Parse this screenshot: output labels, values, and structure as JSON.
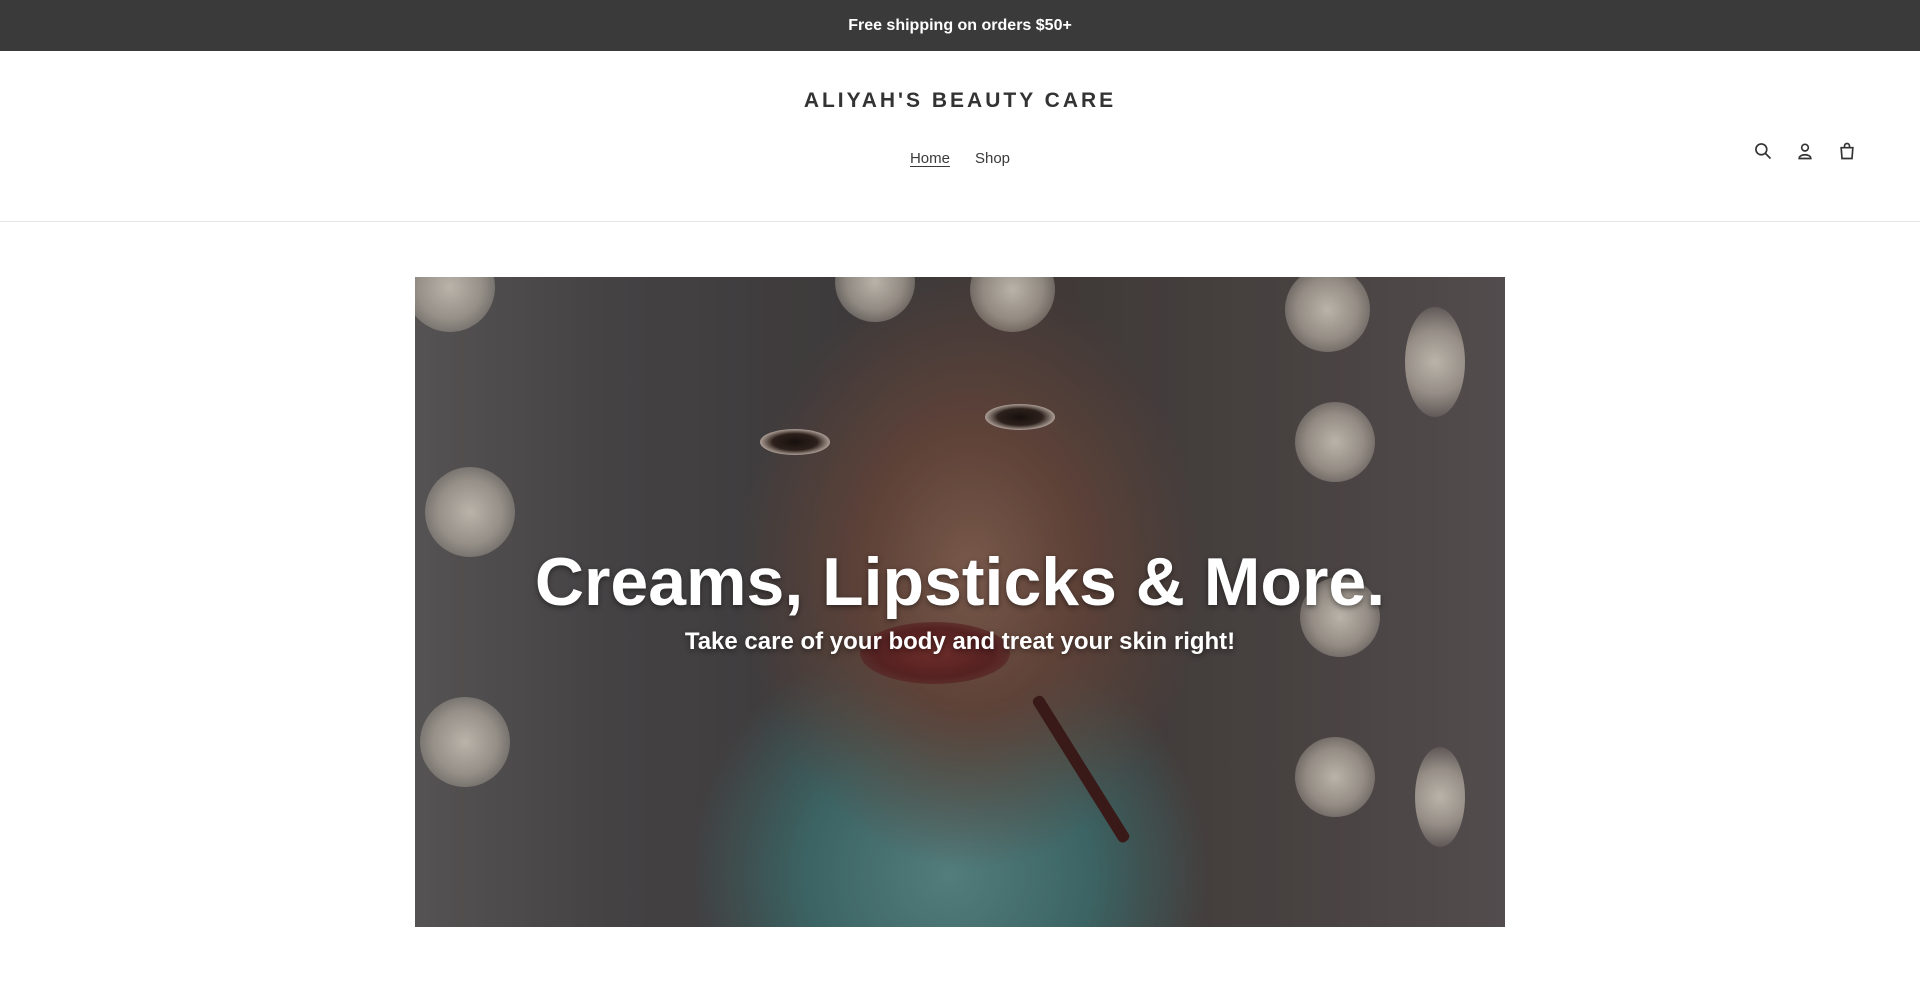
{
  "announcement": {
    "text": "Free shipping on orders $50+"
  },
  "header": {
    "brand": "ALIYAH'S BEAUTY CARE",
    "nav": [
      {
        "label": "Home",
        "active": true
      },
      {
        "label": "Shop",
        "active": false
      }
    ],
    "icons": [
      "search-icon",
      "account-icon",
      "cart-icon"
    ]
  },
  "hero": {
    "title": "Creams, Lipsticks & More.",
    "subtitle": "Take care of your body and treat your skin right!"
  },
  "colors": {
    "announcement_bg": "#3a3a3a",
    "text": "#3a3a3a",
    "hero_text": "#ffffff"
  }
}
